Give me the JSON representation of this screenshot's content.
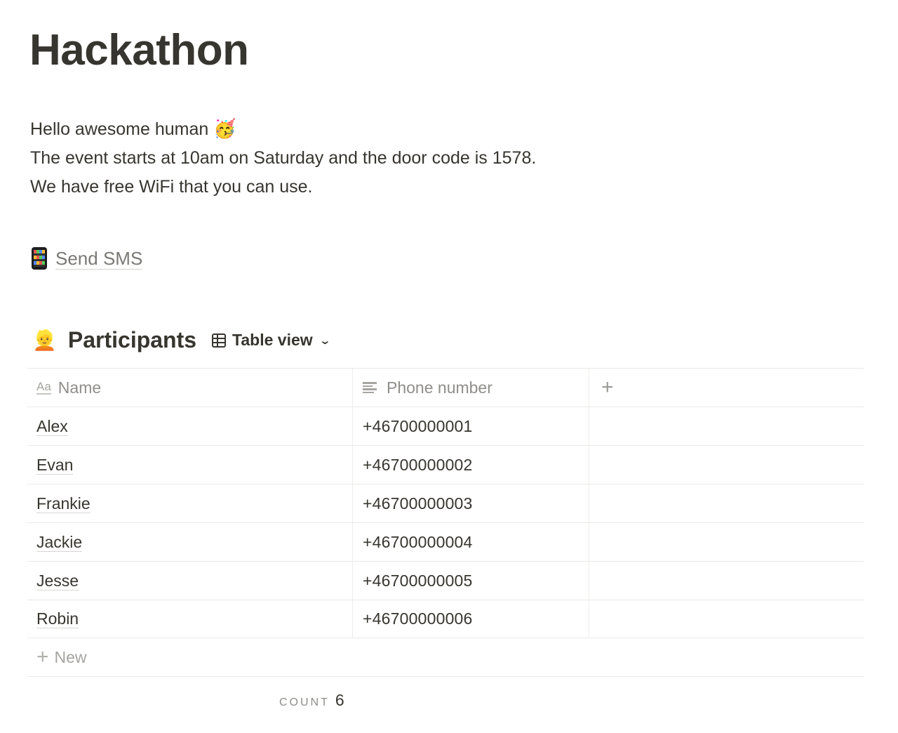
{
  "page": {
    "title": "Hackathon",
    "paragraph": {
      "line1": "Hello awesome human",
      "line1_emoji": "🥳",
      "line2": "The event starts at 10am on Saturday and the door code is 1578.",
      "line3": "We have free WiFi that you can use."
    },
    "sms_link": {
      "icon": "mobile-phone-icon",
      "label": "Send SMS"
    }
  },
  "database": {
    "emoji": "👱",
    "title": "Participants",
    "view": {
      "icon": "table-icon",
      "label": "Table view",
      "chevron": "⌄"
    },
    "columns": [
      {
        "icon": "Aa",
        "icon_name": "title-property-icon",
        "label": "Name"
      },
      {
        "icon": "lines",
        "icon_name": "text-property-icon",
        "label": "Phone number"
      },
      {
        "icon": "+",
        "icon_name": "add-property-icon",
        "label": ""
      }
    ],
    "rows": [
      {
        "name": "Alex",
        "phone": "+46700000001"
      },
      {
        "name": "Evan",
        "phone": "+46700000002"
      },
      {
        "name": "Frankie",
        "phone": "+46700000003"
      },
      {
        "name": "Jackie",
        "phone": "+46700000004"
      },
      {
        "name": "Jesse",
        "phone": "+46700000005"
      },
      {
        "name": "Robin",
        "phone": "+46700000006"
      }
    ],
    "new_row": {
      "icon": "+",
      "label": "New"
    },
    "footer": {
      "count_label": "COUNT",
      "count_value": "6"
    }
  }
}
